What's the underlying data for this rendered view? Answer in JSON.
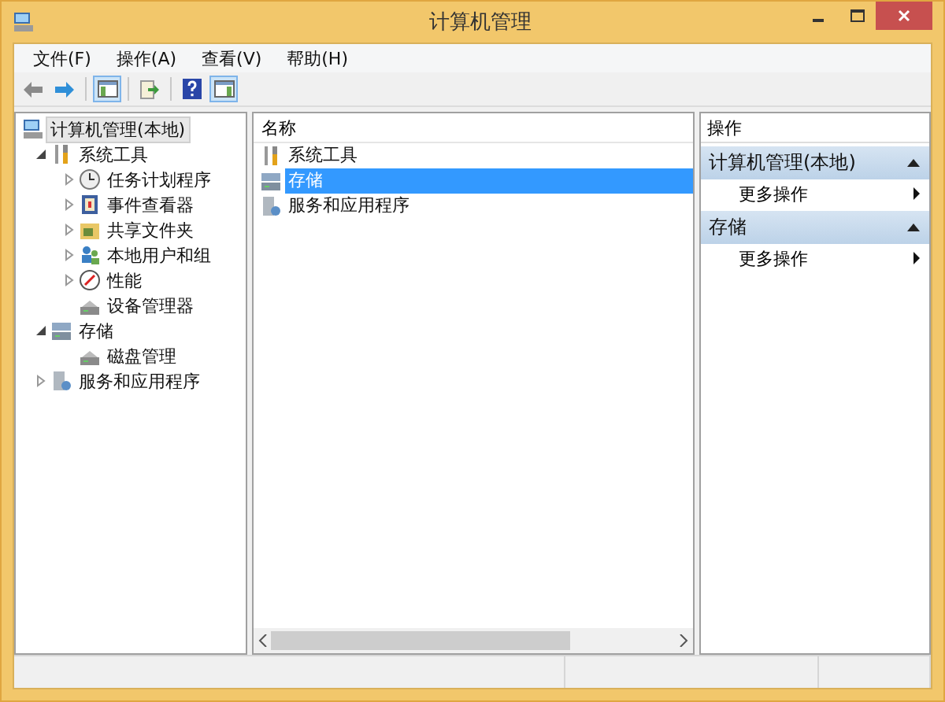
{
  "window": {
    "title": "计算机管理"
  },
  "menu": [
    "文件(F)",
    "操作(A)",
    "查看(V)",
    "帮助(H)"
  ],
  "toolbar": [
    [
      {
        "kind": "back"
      },
      {
        "kind": "forward"
      }
    ],
    [
      {
        "kind": "tree-toggle",
        "on": true
      }
    ],
    [
      {
        "kind": "export"
      }
    ],
    [
      {
        "kind": "help"
      },
      {
        "kind": "action-toggle",
        "on": true
      }
    ]
  ],
  "tree": [
    {
      "label": "计算机管理(本地)",
      "selected": true,
      "children": [
        {
          "label": "系统工具",
          "expanded": true,
          "selected": false,
          "children": [
            {
              "label": "任务计划程序",
              "expanded": false,
              "selected": false
            },
            {
              "label": "事件查看器",
              "expanded": false,
              "selected": false
            },
            {
              "label": "共享文件夹",
              "expanded": false,
              "selected": false
            },
            {
              "label": "本地用户和组",
              "expanded": false,
              "selected": false
            },
            {
              "label": "性能",
              "expanded": false,
              "selected": false
            },
            {
              "label": "设备管理器",
              "selected": false
            }
          ]
        },
        {
          "label": "存储",
          "expanded": true,
          "selected": false,
          "children": [
            {
              "label": "磁盘管理",
              "selected": false
            }
          ]
        },
        {
          "label": "服务和应用程序",
          "expanded": false,
          "selected": false
        }
      ]
    }
  ],
  "list": {
    "column": "名称",
    "rows": [
      {
        "label": "系统工具",
        "selected": false
      },
      {
        "label": "存储",
        "selected": true
      },
      {
        "label": "服务和应用程序",
        "selected": false
      }
    ]
  },
  "actions": {
    "title": "操作",
    "sections": [
      {
        "title": "计算机管理(本地)",
        "expanded": true,
        "items": [
          "更多操作"
        ]
      },
      {
        "title": "存储",
        "expanded": true,
        "items": [
          "更多操作"
        ]
      }
    ]
  }
}
